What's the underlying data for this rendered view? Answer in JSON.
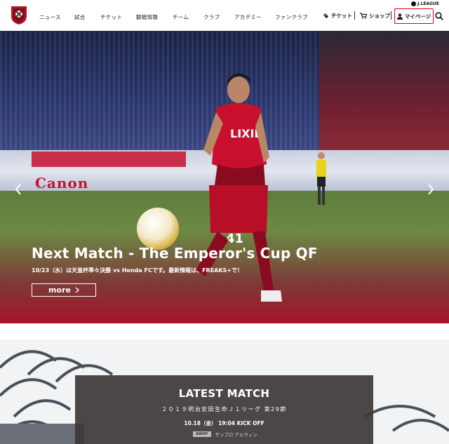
{
  "header": {
    "nav": [
      "ニュース",
      "試合",
      "チケット",
      "観戦情報",
      "チーム",
      "クラブ",
      "アカデミー",
      "ファンクラブ"
    ],
    "ticket_label": "チケット",
    "shop_label": "ショップ",
    "mypage_label": "マイページ",
    "jleague_label": "J.LEAGUE"
  },
  "hero": {
    "title": "Next Match - The Emperor's Cup QF",
    "subtitle": "10/23（水）は天皇杯準々決勝 vs Honda FCです。最新情報は、FREAKS+で！",
    "more_label": "more",
    "ad_text": "Canon",
    "player_number": "41",
    "sponsor_text": "LIXIL"
  },
  "latest_match": {
    "title": "LATEST MATCH",
    "competition": "２０１９明治安田生命Ｊ１リーグ 第29節",
    "date": "10.18（金） 19:04 KICK OFF",
    "venue_type": "AWAY",
    "venue": "サンプロ アルウィン"
  },
  "colors": {
    "accent": "#d9001b",
    "hero_red": "#b0102a"
  }
}
